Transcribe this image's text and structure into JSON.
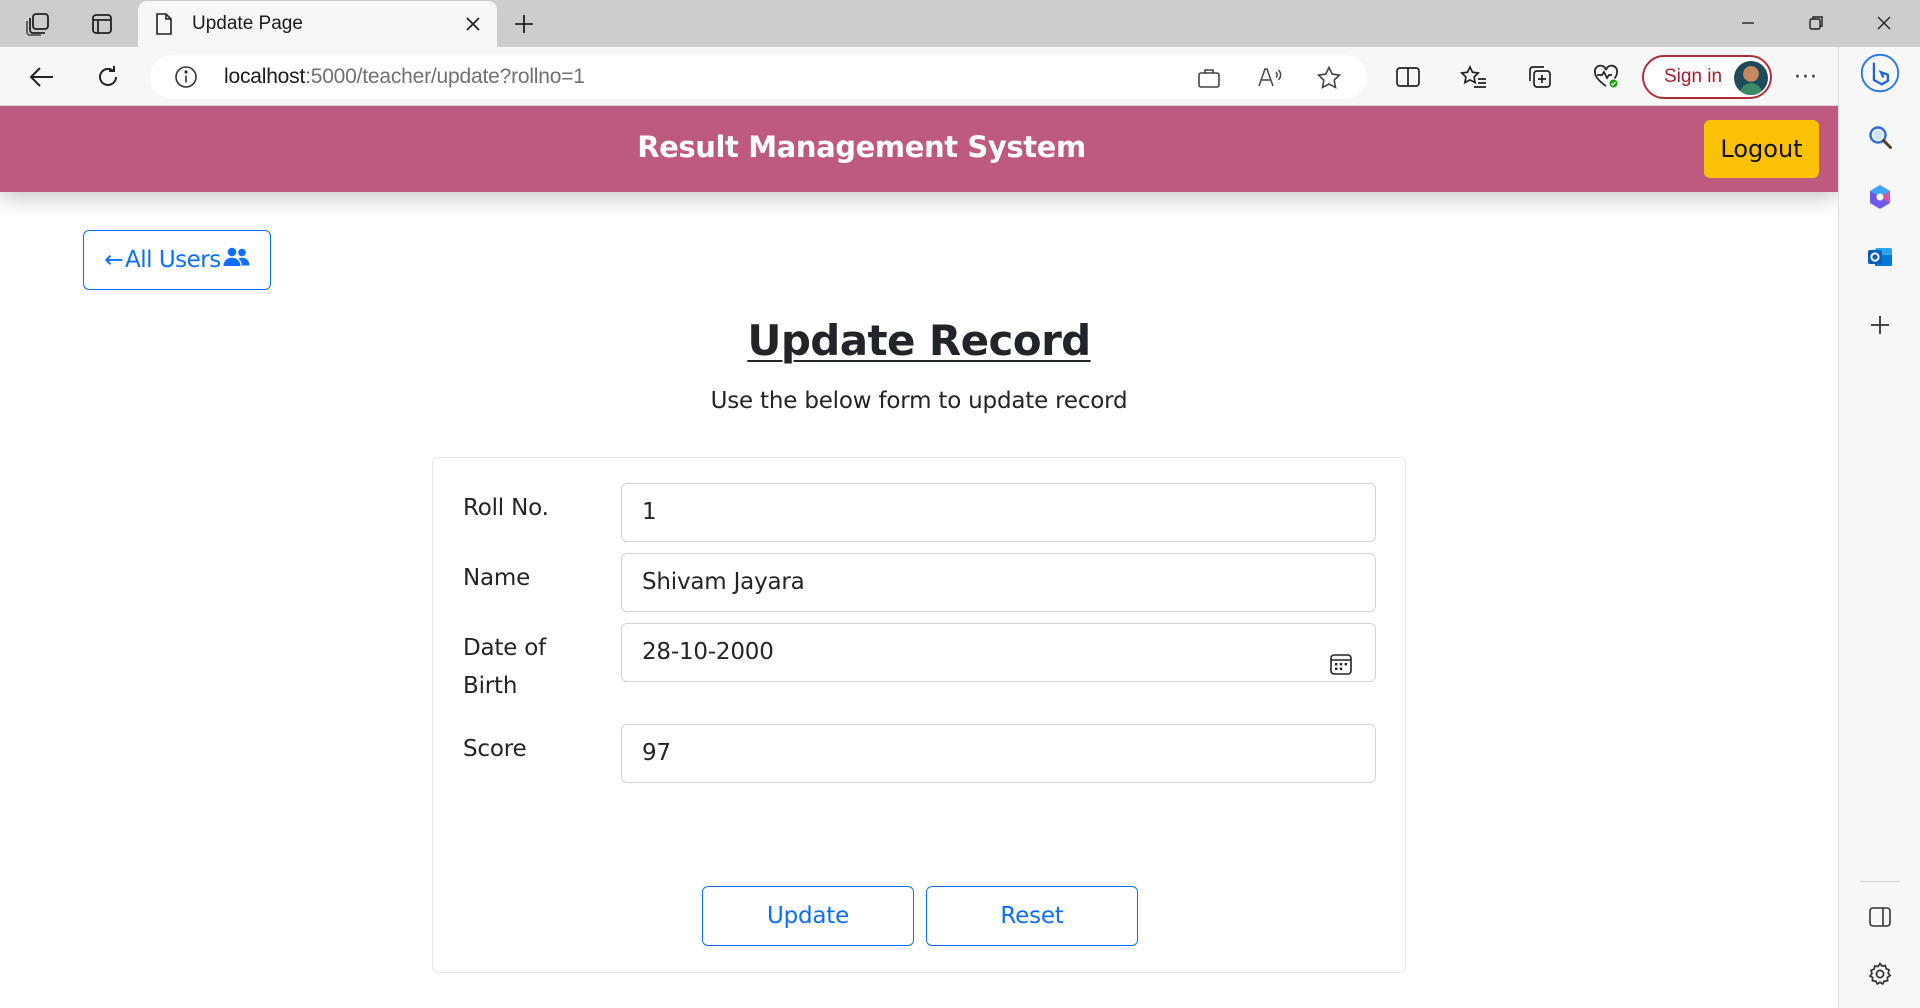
{
  "browser": {
    "tab_title": "Update Page",
    "url_host": "localhost",
    "url_path": ":5000/teacher/update?rollno=1",
    "signin_label": "Sign in",
    "more_label": "···"
  },
  "navbar": {
    "brand": "Result Management System",
    "logout_label": "Logout"
  },
  "back_link": {
    "arrow": "←",
    "label": "All Users"
  },
  "page": {
    "title": "Update Record",
    "subtitle": "Use the below form to update record"
  },
  "form": {
    "fields": [
      {
        "label": "Roll No.",
        "value": "1"
      },
      {
        "label": "Name",
        "value": "Shivam Jayara"
      },
      {
        "label_line1": "Date of",
        "label_line2": "Birth",
        "value": "28-10-2000"
      },
      {
        "label": "Score",
        "value": "97"
      }
    ],
    "update_label": "Update",
    "reset_label": "Reset"
  },
  "colors": {
    "navbar_bg": "#be5a80",
    "logout_bg": "#fbc107",
    "primary": "#0d6efd",
    "signin_border": "#b22d3a"
  }
}
